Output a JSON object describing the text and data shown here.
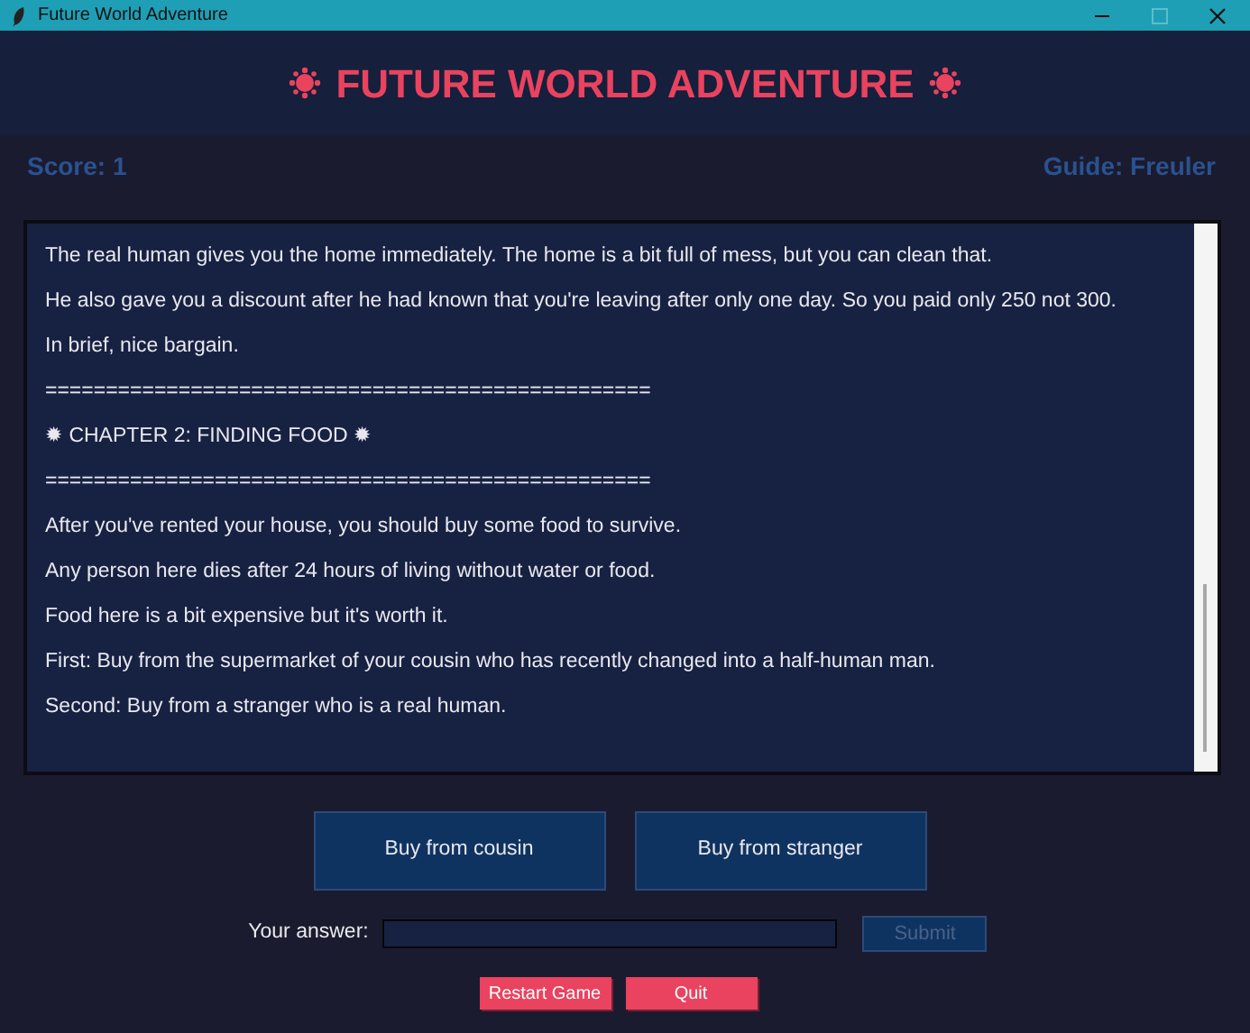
{
  "window": {
    "title": "Future World Adventure"
  },
  "header": {
    "title": "FUTURE WORLD ADVENTURE"
  },
  "status": {
    "score": "Score: 1",
    "guide": "Guide: Freuler"
  },
  "story": {
    "lines": [
      "The real human gives you the home immediately. The home is a bit full of mess, but you can clean that.",
      "He also gave you a discount after he had known that you're leaving after only one day. So you paid only 250 not 300.",
      "In brief, nice bargain.",
      "==================================================",
      "✹ CHAPTER 2: FINDING FOOD ✹",
      "==================================================",
      "After you've rented your house, you should buy some food to survive.",
      "Any person here dies after 24 hours of living without water or food.",
      "Food here is a bit expensive but it's worth it.",
      "First: Buy from the supermarket of your cousin who has recently changed into a half-human man.",
      "Second: Buy from a stranger who is a real human."
    ]
  },
  "choices": [
    {
      "label": "Buy from cousin"
    },
    {
      "label": "Buy from stranger"
    }
  ],
  "answer": {
    "label": "Your answer:",
    "submit": {
      "label": "Submit",
      "disabled": true
    }
  },
  "actions": [
    {
      "label": "Restart Game"
    },
    {
      "label": "Quit"
    }
  ]
}
